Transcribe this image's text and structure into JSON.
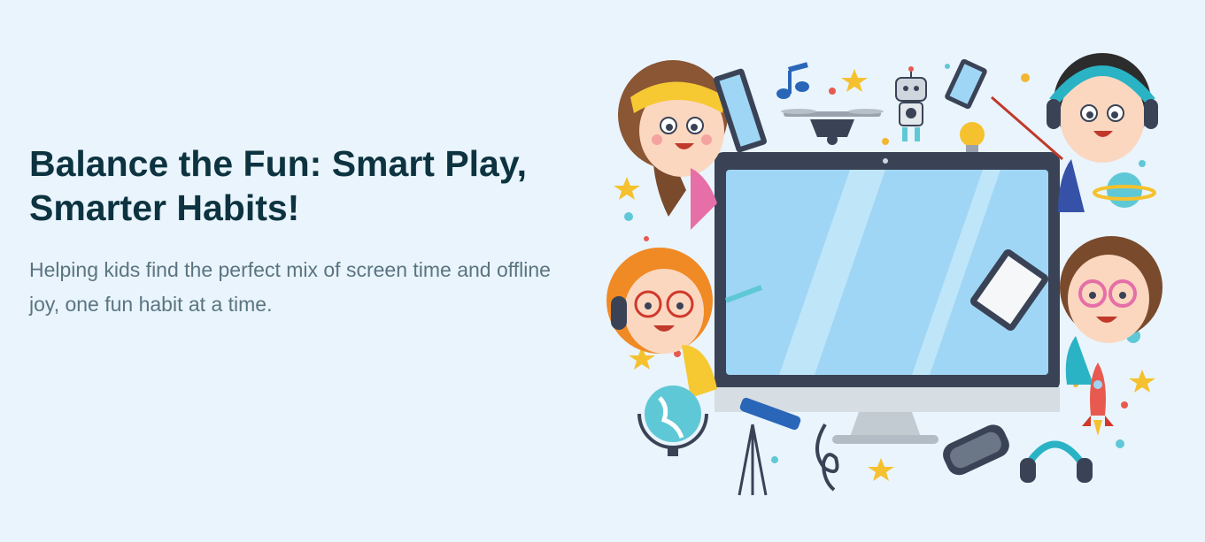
{
  "hero": {
    "title": "Balance the Fun: Smart Play,\nSmarter Habits!",
    "subtitle": "Helping kids find the perfect mix of screen time and offline joy, one fun habit at a time."
  },
  "illustration": {
    "icons": [
      "kid-yellow-headband",
      "kid-teal-headphones",
      "kid-orange-hair",
      "kid-pink-glasses",
      "monitor",
      "drone",
      "robot",
      "music-note",
      "lightbulb",
      "planet",
      "rocket",
      "globe",
      "telescope",
      "treble-clef",
      "vr-headset",
      "headphones",
      "tablet",
      "pencil",
      "stars"
    ]
  },
  "colors": {
    "background": "#e9f4fd",
    "title": "#0d3340",
    "subtitle": "#5b7580",
    "screen": "#9fd6f5",
    "monitor_frame": "#3a4356"
  }
}
